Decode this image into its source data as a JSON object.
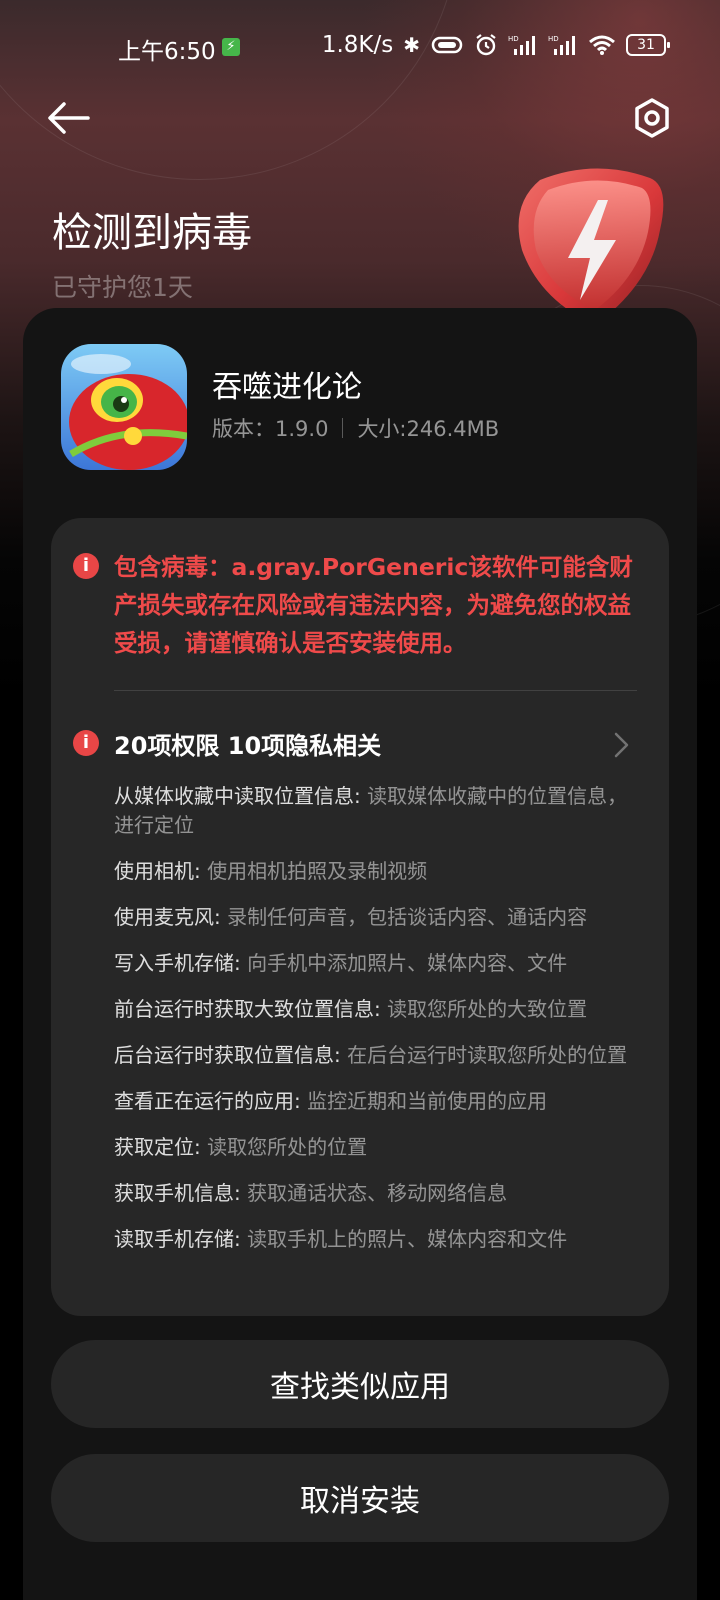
{
  "status_bar": {
    "time": "上午6:50",
    "network_speed": "1.8K/s",
    "battery": "31"
  },
  "header": {
    "title": "检测到病毒",
    "subtitle": "已守护您1天"
  },
  "app": {
    "name": "吞噬进化论",
    "version": "版本：1.9.0",
    "size": "大小:246.4MB"
  },
  "warning": {
    "text": "包含病毒：a.gray.PorGeneric该软件可能含财产损失或存在风险或有违法内容，为避免您的权益受损，请谨慎确认是否安装使用。"
  },
  "permissions": {
    "header": "20项权限 10项隐私相关",
    "items": [
      {
        "name": "从媒体收藏中读取位置信息:",
        "desc": " 读取媒体收藏中的位置信息，进行定位"
      },
      {
        "name": "使用相机:",
        "desc": " 使用相机拍照及录制视频"
      },
      {
        "name": "使用麦克风:",
        "desc": " 录制任何声音，包括谈话内容、通话内容"
      },
      {
        "name": "写入手机存储:",
        "desc": " 向手机中添加照片、媒体内容、文件"
      },
      {
        "name": "前台运行时获取大致位置信息:",
        "desc": " 读取您所处的大致位置"
      },
      {
        "name": "后台运行时获取位置信息:",
        "desc": " 在后台运行时读取您所处的位置"
      },
      {
        "name": "查看正在运行的应用:",
        "desc": " 监控近期和当前使用的应用"
      },
      {
        "name": "获取定位:",
        "desc": " 读取您所处的位置"
      },
      {
        "name": "获取手机信息:",
        "desc": " 获取通话状态、移动网络信息"
      },
      {
        "name": "读取手机存储:",
        "desc": " 读取手机上的照片、媒体内容和文件"
      }
    ]
  },
  "buttons": {
    "find_similar": "查找类似应用",
    "cancel_install": "取消安装"
  },
  "colors": {
    "warning_red": "#ef4a4a",
    "card_bg": "#141414",
    "panel_bg": "#272727"
  }
}
